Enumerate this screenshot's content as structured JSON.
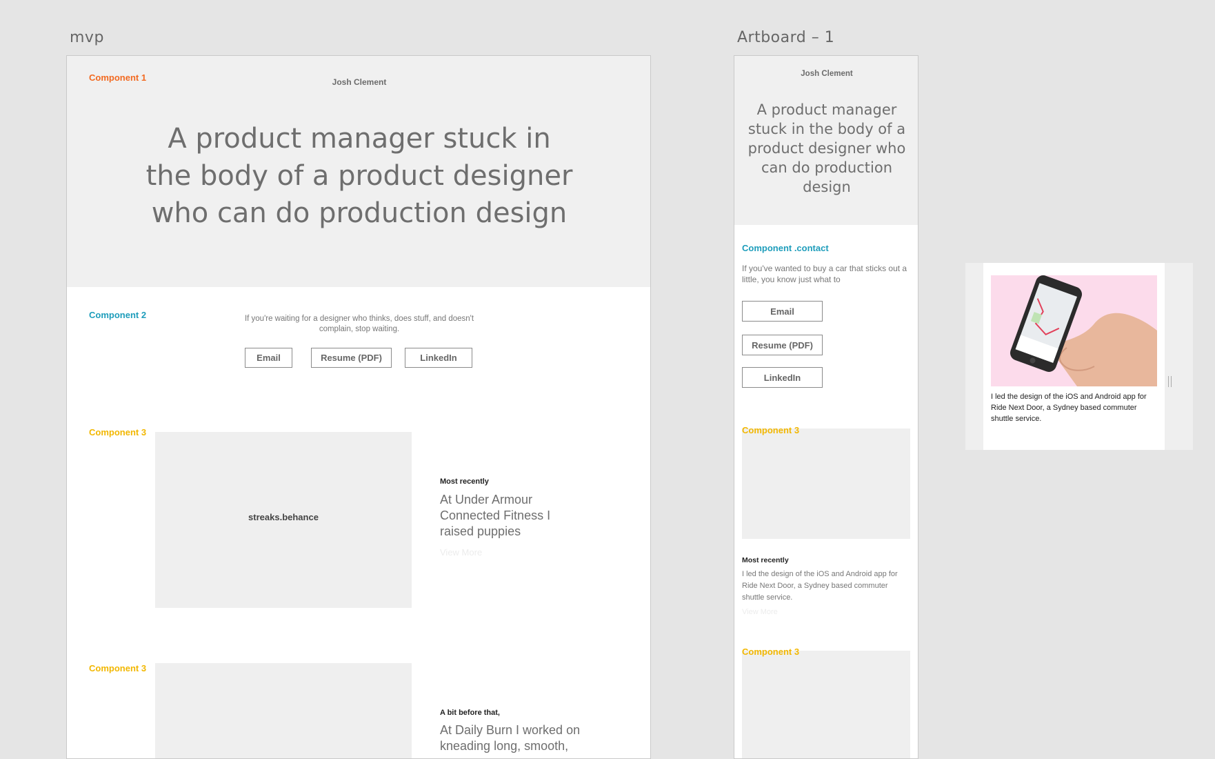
{
  "artboards": {
    "desktop_title": "mvp",
    "mobile_title": "Artboard – 1"
  },
  "desktop": {
    "component1_label": "Component 1",
    "name": "Josh Clement",
    "headline": "A product manager stuck in the body of a product designer who can do production design",
    "component2_label": "Component 2",
    "intro": "If you're waiting for a designer who thinks, does stuff, and doesn't complain, stop waiting.",
    "buttons": {
      "email": "Email",
      "resume": "Resume (PDF)",
      "linkedin": "LinkedIn"
    },
    "project1": {
      "label": "Component 3",
      "placeholder": "streaks.behance",
      "kicker": "Most recently",
      "lede": "At Under Armour Connected Fitness I raised puppies",
      "view_more": "View More"
    },
    "project2": {
      "label": "Component 3",
      "kicker": "A bit before that,",
      "lede": "At Daily Burn I worked on kneading long, smooth,"
    }
  },
  "mobile": {
    "name": "Josh Clement",
    "headline": "A product manager stuck in the body of a product designer who can do production design",
    "contact_label": "Component .contact",
    "intro": "If you've wanted to buy a car that sticks out a little, you know just what to",
    "buttons": {
      "email": "Email",
      "resume": "Resume (PDF)",
      "linkedin": "LinkedIn"
    },
    "project1": {
      "label": "Component 3",
      "kicker": "Most recently",
      "body": "I led the design of the iOS and Android app for Ride Next Door, a Sydney based commuter shuttle service.",
      "view_more": "View More"
    },
    "project2": {
      "label": "Component 3"
    }
  },
  "card": {
    "body": "I led the design of the iOS and Android app for Ride Next Door, a Sydney based commuter shuttle service."
  },
  "colors": {
    "canvas": "#e5e5e5",
    "hero_bg": "#f0f0f0",
    "component_orange": "#f26a21",
    "component_teal": "#1e9dbb",
    "component_yellow": "#f2b700",
    "card_image_bg": "#fcdbeb"
  }
}
